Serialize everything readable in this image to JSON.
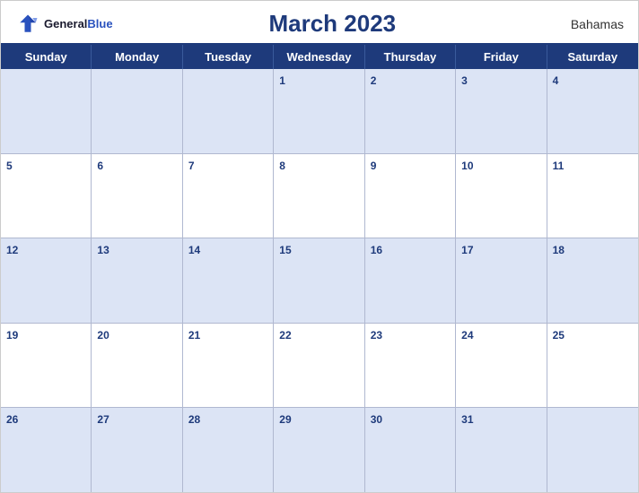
{
  "header": {
    "logo_general": "General",
    "logo_blue": "Blue",
    "month_title": "March 2023",
    "country": "Bahamas"
  },
  "day_headers": [
    "Sunday",
    "Monday",
    "Tuesday",
    "Wednesday",
    "Thursday",
    "Friday",
    "Saturday"
  ],
  "weeks": [
    [
      {
        "num": "",
        "empty": true
      },
      {
        "num": "",
        "empty": true
      },
      {
        "num": "",
        "empty": true
      },
      {
        "num": "1",
        "empty": false
      },
      {
        "num": "2",
        "empty": false
      },
      {
        "num": "3",
        "empty": false
      },
      {
        "num": "4",
        "empty": false
      }
    ],
    [
      {
        "num": "5",
        "empty": false
      },
      {
        "num": "6",
        "empty": false
      },
      {
        "num": "7",
        "empty": false
      },
      {
        "num": "8",
        "empty": false
      },
      {
        "num": "9",
        "empty": false
      },
      {
        "num": "10",
        "empty": false
      },
      {
        "num": "11",
        "empty": false
      }
    ],
    [
      {
        "num": "12",
        "empty": false
      },
      {
        "num": "13",
        "empty": false
      },
      {
        "num": "14",
        "empty": false
      },
      {
        "num": "15",
        "empty": false
      },
      {
        "num": "16",
        "empty": false
      },
      {
        "num": "17",
        "empty": false
      },
      {
        "num": "18",
        "empty": false
      }
    ],
    [
      {
        "num": "19",
        "empty": false
      },
      {
        "num": "20",
        "empty": false
      },
      {
        "num": "21",
        "empty": false
      },
      {
        "num": "22",
        "empty": false
      },
      {
        "num": "23",
        "empty": false
      },
      {
        "num": "24",
        "empty": false
      },
      {
        "num": "25",
        "empty": false
      }
    ],
    [
      {
        "num": "26",
        "empty": false
      },
      {
        "num": "27",
        "empty": false
      },
      {
        "num": "28",
        "empty": false
      },
      {
        "num": "29",
        "empty": false
      },
      {
        "num": "30",
        "empty": false
      },
      {
        "num": "31",
        "empty": false
      },
      {
        "num": "",
        "empty": true
      }
    ]
  ]
}
